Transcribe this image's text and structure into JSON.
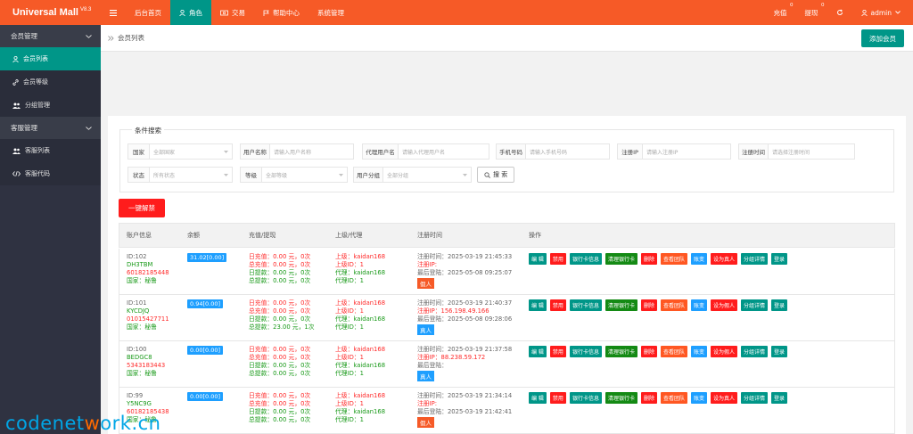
{
  "brand": {
    "name": "Universal Mall",
    "version": "V8.3"
  },
  "topnav": [
    {
      "label": "",
      "icon": "menu-icon"
    },
    {
      "label": "后台首页",
      "icon": ""
    },
    {
      "label": "角色",
      "icon": "user-icon"
    },
    {
      "label": "交易",
      "icon": "money-icon"
    },
    {
      "label": "帮助中心",
      "icon": "flag-icon"
    },
    {
      "label": "系统管理",
      "icon": ""
    }
  ],
  "topright": {
    "recharge": "充值",
    "recharge_count": "0",
    "withdraw": "提现",
    "withdraw_count": "0",
    "user": "admin"
  },
  "sidebar": {
    "group1": "会员管理",
    "items1": [
      "会员列表",
      "会员等级",
      "分组管理"
    ],
    "group2": "客服管理",
    "items2": [
      "客服列表",
      "客服代码"
    ]
  },
  "breadcrumb": "会员列表",
  "add_member": "添加会员",
  "search": {
    "legend": "条件搜索",
    "country": {
      "label": "国家",
      "placeholder": "全部国家"
    },
    "username": {
      "label": "用户名称",
      "placeholder": "请输入用户名称"
    },
    "agent": {
      "label": "代理用户名",
      "placeholder": "请输入代理用户名"
    },
    "phone": {
      "label": "手机号码",
      "placeholder": "请输入手机号码"
    },
    "ip": {
      "label": "注册IP",
      "placeholder": "请输入注册IP"
    },
    "regtime": {
      "label": "注册时间",
      "placeholder": "请选择注册时间"
    },
    "status": {
      "label": "状态",
      "placeholder": "所有状态"
    },
    "level": {
      "label": "等级",
      "placeholder": "全部等级"
    },
    "group": {
      "label": "用户分组",
      "placeholder": "全部分组"
    },
    "button": "搜 索"
  },
  "unban": "一键解禁",
  "table": {
    "headers": [
      "账户信息",
      "余额",
      "充值/提现",
      "上级/代理",
      "注册时间",
      "操作"
    ],
    "ops": [
      "编 辑",
      "禁用",
      "银行卡信息",
      "清理银行卡",
      "删除",
      "查看团队",
      "账变",
      "设为真人",
      "分组详情",
      "登录"
    ],
    "ops_alt": [
      "编 辑",
      "禁用",
      "银行卡信息",
      "清理银行卡",
      "删除",
      "查看团队",
      "账变",
      "设为假人",
      "分组详情",
      "登录"
    ],
    "rows": [
      {
        "id": "ID:102",
        "name": "DH3TBM",
        "phone": "60182185448",
        "country": "国家：秘鲁",
        "balance": "31.02[0.00]",
        "finance": [
          "日充值：0.00 元，0次",
          "总充值：0.00 元，0次",
          "日提款：0.00 元，0次",
          "总提款：0.00 元，0次"
        ],
        "parent": [
          "上级：kaidan168",
          "上级ID：1",
          "代理：kaidan168",
          "代理ID：1"
        ],
        "reg": [
          "注册时间：2025-03-19 21:45:33",
          "注册IP:",
          "最后登陆：2025-05-08 09:25:07"
        ],
        "tag": "假人",
        "tagtype": "fake"
      },
      {
        "id": "ID:101",
        "name": "KYCDJQ",
        "phone": "01015427711",
        "country": "国家：秘鲁",
        "balance": "0.94[0.00]",
        "finance": [
          "日充值：0.00 元，0次",
          "总充值：0.00 元，0次",
          "日提款：0.00 元，0次",
          "总提款：23.00 元，1次"
        ],
        "parent": [
          "上级：kaidan168",
          "上级ID：1",
          "代理：kaidan168",
          "代理ID：1"
        ],
        "reg": [
          "注册时间：2025-03-19 21:40:37",
          "注册IP：156.198.49.166",
          "最后登陆：2025-05-08 09:28:06"
        ],
        "tag": "真人",
        "tagtype": "real"
      },
      {
        "id": "ID:100",
        "name": "BEDGC8",
        "phone": "5343183443",
        "country": "国家：秘鲁",
        "balance": "0.00[0.00]",
        "finance": [
          "日充值：0.00 元，0次",
          "总充值：0.00 元，0次",
          "日提款：0.00 元，0次",
          "总提款：0.00 元，0次"
        ],
        "parent": [
          "上级：kaidan168",
          "上级ID：1",
          "代理：kaidan168",
          "代理ID：1"
        ],
        "reg": [
          "注册时间：2025-03-19 21:37:58",
          "注册IP：88.238.59.172",
          "最后登陆："
        ],
        "tag": "真人",
        "tagtype": "real"
      },
      {
        "id": "ID:99",
        "name": "Y5NC9G",
        "phone": "60182185438",
        "country": "国家：秘鲁",
        "balance": "0.00[0.00]",
        "finance": [
          "日充值：0.00 元，0次",
          "总充值：0.00 元，0次",
          "日提款：0.00 元，0次",
          "总提款：0.00 元，0次"
        ],
        "parent": [
          "上级：kaidan168",
          "上级ID：1",
          "代理：kaidan168",
          "代理ID：1"
        ],
        "reg": [
          "注册时间：2025-03-19 21:34:14",
          "注册IP:",
          "最后登陆：2025-03-19 21:42:41"
        ],
        "tag": "假人",
        "tagtype": "fake"
      }
    ]
  },
  "watermark": {
    "a": "codenet",
    "b": "w",
    "c": "ork.cn"
  },
  "colors": {
    "primary": "#f65a27",
    "teal": "#009688",
    "red": "#ff1c1c",
    "blue": "#1e9fff",
    "green": "#148a14",
    "orange": "#ff5722"
  }
}
